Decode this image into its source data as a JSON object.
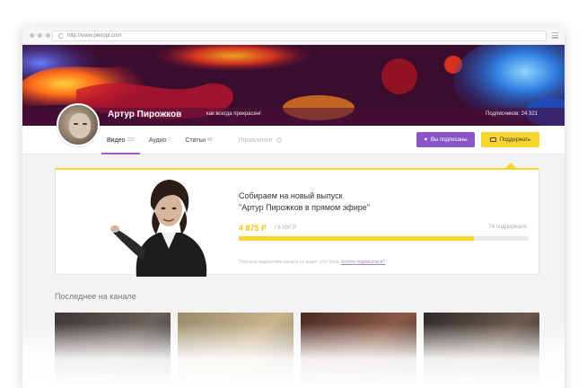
{
  "browser": {
    "url": "http://www.penopl.com"
  },
  "profile": {
    "name": "Артур Пирожков",
    "tagline": "как всегда прекрасен!",
    "subscribers": "Подписчиков: 24 321"
  },
  "tabs": [
    {
      "label": "Видео",
      "count": "123"
    },
    {
      "label": "Аудио",
      "count": "7"
    },
    {
      "label": "Статьи",
      "count": "48"
    },
    {
      "label": "Управление",
      "count": ""
    }
  ],
  "actions": {
    "subscribed_label": "Вы подписаны",
    "support_label": "Поддержать"
  },
  "goal": {
    "title_line1": "Собираем на новый выпуск",
    "title_line2": "\"Артур Пирожков в прямом эфире\"",
    "amount": "4 875 Р",
    "target": "/ 6 000 Р",
    "supporters": "74 поддержало",
    "progress_fraction": 0.8125,
    "note_text": "Платные подписчики канала не видят этот блок.",
    "note_link": "Хотите подписаться?"
  },
  "latest": {
    "title": "Последнее на канале"
  },
  "colors": {
    "accent_purple": "#8a56c7",
    "accent_yellow": "#f7d52e"
  }
}
